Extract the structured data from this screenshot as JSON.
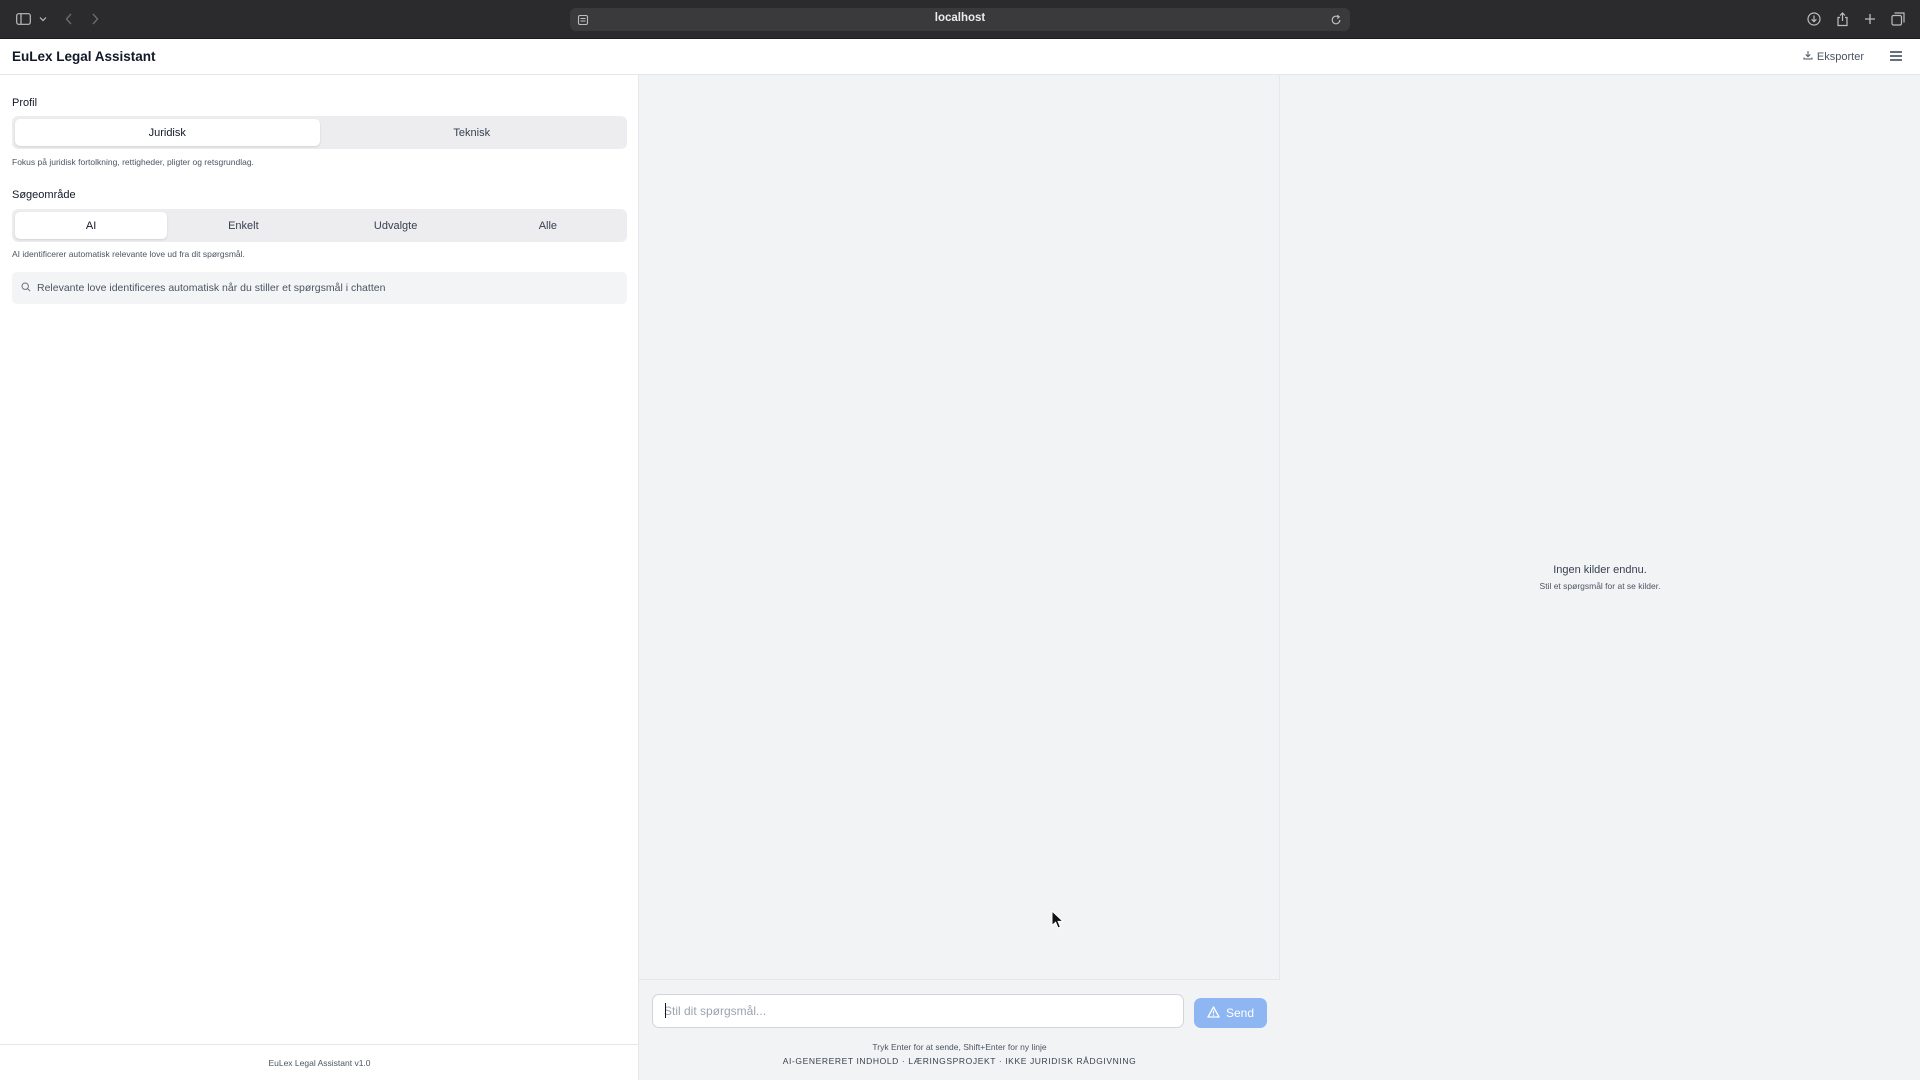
{
  "browser": {
    "url": "localhost"
  },
  "header": {
    "title": "EuLex Legal Assistant",
    "export_label": "Eksporter"
  },
  "left": {
    "profile_label": "Profil",
    "profile_options": [
      "Juridisk",
      "Teknisk"
    ],
    "profile_selected": "Juridisk",
    "profile_hint": "Fokus på juridisk fortolkning, rettigheder, pligter og retsgrundlag.",
    "scope_label": "Søgeområde",
    "scope_options": [
      "AI",
      "Enkelt",
      "Udvalgte",
      "Alle"
    ],
    "scope_selected": "AI",
    "scope_hint": "AI identificerer automatisk relevante love ud fra dit spørgsmål.",
    "law_search_text": "Relevante love identificeres automatisk når du stiller et spørgsmål i chatten",
    "footer": "EuLex Legal Assistant v1.0"
  },
  "chat": {
    "input_placeholder": "Stil dit spørgsmål...",
    "input_value": "",
    "send_label": "Send",
    "hint": "Tryk Enter for at sende, Shift+Enter for ny linje",
    "disclaimer": "AI-GENERERET INDHOLD · LÆRINGSPROJEKT · IKKE JURIDISK RÅDGIVNING"
  },
  "sources": {
    "empty_title": "Ingen kilder endnu.",
    "empty_subtitle": "Stil et spørgsmål for at se kilder."
  },
  "colors": {
    "send_button": "#8eb6f2",
    "panel_bg": "#f2f3f5",
    "browser_bar": "#2b2b2d"
  }
}
